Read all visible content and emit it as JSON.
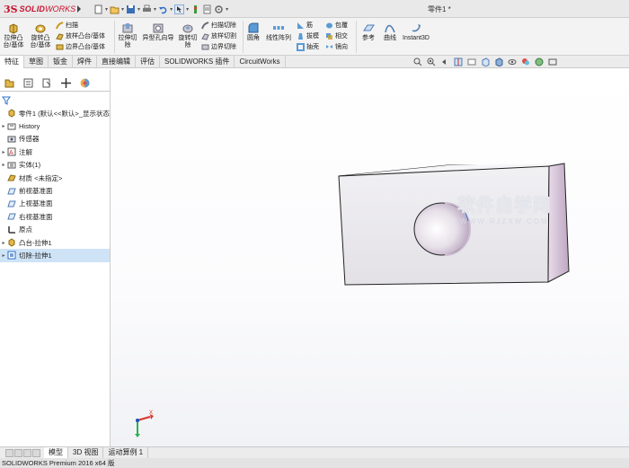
{
  "app": {
    "brand_ds": "3S",
    "brand_solid": "SOLID",
    "brand_works": "WORKS",
    "document_title": "零件1 *"
  },
  "ribbon": {
    "extrude_boss": "拉伸凸\n台/基体",
    "revolve_boss": "旋转凸\n台/基体",
    "sweep": "扫描",
    "loft_boss": "放样凸台/基体",
    "boundary_boss": "边界凸台/基体",
    "extrude_cut": "拉伸切\n除",
    "hole_wizard": "异型孔向导",
    "revolve_cut": "旋转切\n除",
    "swept_cut": "扫描切除",
    "loft_cut": "放样切割",
    "boundary_cut": "边界切除",
    "fillet": "圆角",
    "linear_pattern": "线性阵列",
    "rib": "筋",
    "draft": "拔模",
    "shell": "抽壳",
    "wrap": "包覆",
    "intersect": "相交",
    "mirror": "镜向",
    "reference": "参考",
    "curves": "曲线",
    "instant3d": "Instant3D"
  },
  "tabs": [
    "特征",
    "草图",
    "钣金",
    "焊件",
    "直接编辑",
    "评估",
    "SOLIDWORKS 插件",
    "CircuitWorks"
  ],
  "tree": {
    "root": "零件1  (默认<<默认>_显示状态",
    "items": [
      {
        "label": "History",
        "expand": true
      },
      {
        "label": "传感器",
        "expand": false
      },
      {
        "label": "注解",
        "expand": true
      },
      {
        "label": "实体(1)",
        "expand": true
      },
      {
        "label": "材质 <未指定>",
        "expand": false
      },
      {
        "label": "前视基准面",
        "expand": false
      },
      {
        "label": "上视基准面",
        "expand": false
      },
      {
        "label": "右视基准面",
        "expand": false
      },
      {
        "label": "原点",
        "expand": false
      },
      {
        "label": "凸台-拉伸1",
        "expand": true
      },
      {
        "label": "切除-拉伸1",
        "expand": true
      }
    ]
  },
  "watermark": {
    "title": "软件自学网",
    "url": "WWW.RJZXW.COM"
  },
  "triad": {
    "x": "X",
    "y": "Y"
  },
  "bottom_tabs": [
    "模型",
    "3D 视图",
    "运动算例 1"
  ],
  "status": "SOLIDWORKS Premium 2016 x64 版",
  "colors": {
    "accent": "#c8102e",
    "selection": "#cfe3f7",
    "block_face": "#eceaed",
    "block_side": "#d9c8dc"
  }
}
